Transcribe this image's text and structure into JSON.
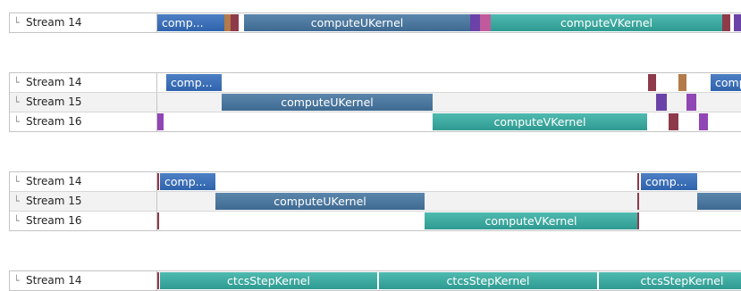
{
  "panels": [
    {
      "rows": [
        {
          "stream": "Stream 14",
          "kernels": [
            {
              "label": "comp...",
              "style": "k-blue2",
              "start": 0,
              "end": 75,
              "align": "left"
            },
            {
              "label": "computeUKernel",
              "style": "k-blue",
              "start": 97,
              "end": 350
            },
            {
              "label": "computeVKernel",
              "style": "k-teal",
              "start": 373,
              "end": 632
            }
          ],
          "marks": [
            {
              "style": "m-orange",
              "start": 73,
              "end": 82
            },
            {
              "style": "m-maroon",
              "start": 82,
              "end": 91
            },
            {
              "style": "m-purple",
              "start": 350,
              "end": 361
            },
            {
              "style": "m-pink",
              "start": 361,
              "end": 373
            },
            {
              "style": "m-maroon",
              "start": 632,
              "end": 641
            },
            {
              "style": "m-purple",
              "start": 645,
              "end": 654
            }
          ]
        }
      ]
    },
    {
      "rows": [
        {
          "stream": "Stream 14",
          "kernels": [
            {
              "label": "comp...",
              "style": "k-blue2",
              "start": 10,
              "end": 72,
              "align": "left"
            },
            {
              "label": "comp",
              "style": "k-blue2",
              "start": 619,
              "end": 680,
              "align": "left"
            }
          ],
          "marks": [
            {
              "style": "m-maroon",
              "start": 549,
              "end": 558
            },
            {
              "style": "m-orange",
              "start": 583,
              "end": 592
            }
          ]
        },
        {
          "stream": "Stream 15",
          "kernels": [
            {
              "label": "computeUKernel",
              "style": "k-blue",
              "start": 72,
              "end": 308
            }
          ],
          "marks": [
            {
              "style": "m-purple",
              "start": 558,
              "end": 570
            },
            {
              "style": "m-violet",
              "start": 592,
              "end": 603
            }
          ]
        },
        {
          "stream": "Stream 16",
          "kernels": [
            {
              "label": "computeVKernel",
              "style": "k-teal",
              "start": 308,
              "end": 548
            }
          ],
          "marks": [
            {
              "style": "m-violet",
              "start": 0,
              "end": 7
            },
            {
              "style": "m-maroon",
              "start": 572,
              "end": 583
            },
            {
              "style": "m-violet",
              "start": 606,
              "end": 616
            }
          ]
        }
      ]
    },
    {
      "rows": [
        {
          "stream": "Stream 14",
          "kernels": [
            {
              "label": "comp...",
              "style": "k-blue2",
              "start": 3,
              "end": 65,
              "align": "left"
            },
            {
              "label": "comp...",
              "style": "k-blue2",
              "start": 541,
              "end": 604,
              "align": "left"
            }
          ],
          "marks": [
            {
              "style": "m-line",
              "start": 0,
              "end": 2
            },
            {
              "style": "m-line",
              "start": 537,
              "end": 539
            }
          ]
        },
        {
          "stream": "Stream 15",
          "kernels": [
            {
              "label": "computeUKernel",
              "style": "k-blue",
              "start": 65,
              "end": 299
            },
            {
              "label": "",
              "style": "k-blue",
              "start": 604,
              "end": 680
            }
          ],
          "marks": [
            {
              "style": "m-line",
              "start": 537,
              "end": 539
            }
          ]
        },
        {
          "stream": "Stream 16",
          "kernels": [
            {
              "label": "computeVKernel",
              "style": "k-teal",
              "start": 299,
              "end": 537
            }
          ],
          "marks": [
            {
              "style": "m-line",
              "start": 0,
              "end": 2
            },
            {
              "style": "m-line",
              "start": 537,
              "end": 539
            }
          ]
        }
      ]
    },
    {
      "rows": [
        {
          "stream": "Stream 14",
          "kernels": [
            {
              "label": "ctcsStepKernel",
              "style": "k-teal",
              "start": 3,
              "end": 246
            },
            {
              "label": "ctcsStepKernel",
              "style": "k-teal",
              "start": 248,
              "end": 492
            },
            {
              "label": "ctcsStepKernel",
              "style": "k-teal",
              "start": 494,
              "end": 680
            }
          ],
          "marks": [
            {
              "style": "m-line",
              "start": 0,
              "end": 2
            }
          ]
        }
      ]
    }
  ]
}
